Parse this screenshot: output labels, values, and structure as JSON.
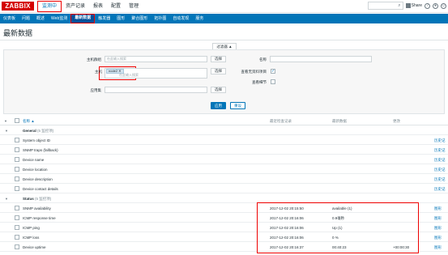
{
  "header": {
    "logo": "ZABBIX",
    "menu": [
      "监测中",
      "资产记录",
      "报表",
      "配置",
      "管理"
    ],
    "active_menu_index": 0,
    "share": "Share"
  },
  "subnav": {
    "items": [
      "仪表板",
      "问题",
      "概述",
      "Web监测",
      "最新数据",
      "触发器",
      "图形",
      "聚合图形",
      "拓扑图",
      "自动发现",
      "服务"
    ],
    "active_index": 4
  },
  "page": {
    "title": "最新数据"
  },
  "filter": {
    "tab_label": "过滤器 ▲",
    "host_group_label": "主机群组",
    "host_group_placeholder": "在此输入搜索",
    "host_label": "主机",
    "host_tag": "node2 ✕",
    "host_placeholder": "在此输入搜索",
    "application_label": "应用集",
    "select_label": "选择",
    "name_label": "名称",
    "show_no_data_label": "查看无资料项目",
    "show_details_label": "查看细节",
    "apply_label": "应用",
    "reset_label": "重设"
  },
  "table": {
    "headers": {
      "name": "名称 ▲",
      "last_check": "最近检查记录",
      "last_value": "最新数据",
      "change": "更改"
    },
    "groups": [
      {
        "name": "General",
        "count": "(5 监控项)",
        "rows": [
          {
            "name": "System object ID",
            "check": "",
            "value": "",
            "change": "",
            "action": "历史记"
          },
          {
            "name": "SNMP traps (fallback)",
            "check": "",
            "value": "",
            "change": "",
            "action": "历史记"
          },
          {
            "name": "Device name",
            "check": "",
            "value": "",
            "change": "",
            "action": "历史记"
          },
          {
            "name": "Device location",
            "check": "",
            "value": "",
            "change": "",
            "action": "历史记"
          },
          {
            "name": "Device description",
            "check": "",
            "value": "",
            "change": "",
            "action": "历史记"
          },
          {
            "name": "Device contact details",
            "check": "",
            "value": "",
            "change": "",
            "action": "历史记"
          }
        ]
      },
      {
        "name": "Status",
        "count": "(5 监控项)",
        "rows": [
          {
            "name": "SNMP availability",
            "check": "2017-12-02 20:15:50",
            "value": "available (1)",
            "change": "",
            "action": "图形"
          },
          {
            "name": "ICMP response time",
            "check": "2017-12-02 20:16:06",
            "value": "0.9毫秒",
            "change": "",
            "action": "图形"
          },
          {
            "name": "ICMP ping",
            "check": "2017-12-02 20:16:06",
            "value": "Up (1)",
            "change": "",
            "action": "图形"
          },
          {
            "name": "ICMP loss",
            "check": "2017-12-02 20:16:06",
            "value": "0 %",
            "change": "",
            "action": "图形"
          },
          {
            "name": "Device uptime",
            "check": "2017-12-02 20:16:37",
            "value": "00:40:23",
            "change": "+00:00:30",
            "action": "图形"
          }
        ]
      }
    ]
  }
}
